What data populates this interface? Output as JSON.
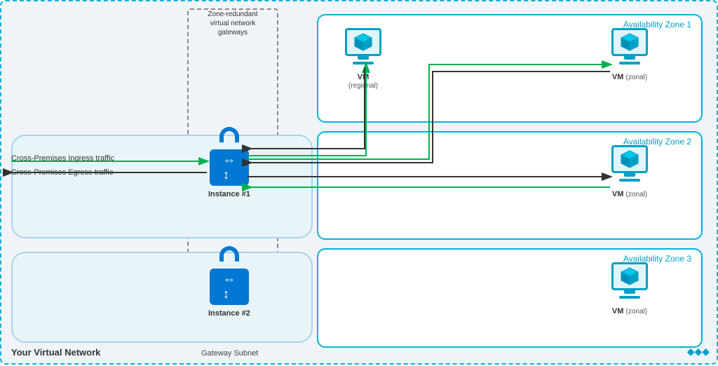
{
  "diagram": {
    "title": "Your Virtual Network",
    "gatewaySubnet": "Gateway Subnet",
    "zoneRedundantLabel": "Zone-redundant\nvirtual network\ngateways",
    "ingressLabel": "Cross-Premises Ingress traffic",
    "egressLabel": "Cross-Premises Egress traffic",
    "availabilityZones": [
      {
        "id": "az1",
        "label": "Availability Zone 1"
      },
      {
        "id": "az2",
        "label": "Availability Zone 2"
      },
      {
        "id": "az3",
        "label": "Availability Zone 3"
      }
    ],
    "vms": [
      {
        "id": "vm-regional",
        "label": "VM",
        "sublabel": "(regional)"
      },
      {
        "id": "vm-zonal1",
        "label": "VM",
        "sublabel": "(zonal)"
      },
      {
        "id": "vm-zonal2",
        "label": "VM",
        "sublabel": "(zonal)"
      },
      {
        "id": "vm-zonal3",
        "label": "VM",
        "sublabel": "(zonal)"
      }
    ],
    "gateways": [
      {
        "id": "instance1",
        "label": "Instance #1"
      },
      {
        "id": "instance2",
        "label": "Instance #2"
      }
    ],
    "colors": {
      "az_border": "#00b4d8",
      "lock_blue": "#0078d4",
      "arrow_green": "#00b050",
      "arrow_dark": "#333333",
      "monitor_border": "#00a0c6"
    }
  }
}
